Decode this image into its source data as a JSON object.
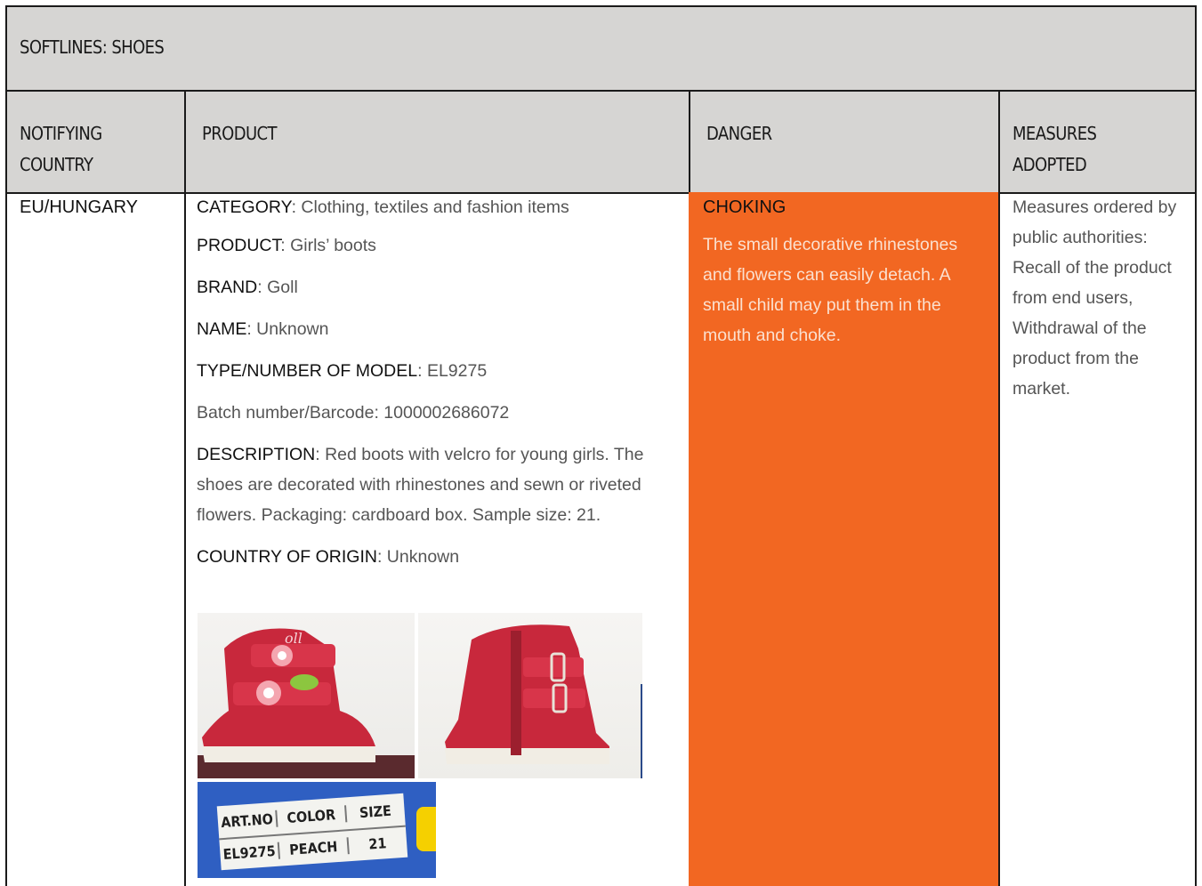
{
  "section": {
    "title": "SOFTLINES: SHOES"
  },
  "headers": {
    "country": "NOTIFYING COUNTRY",
    "product": "PRODUCT",
    "danger": "DANGER",
    "measures": "MEASURES ADOPTED"
  },
  "row": {
    "country": "EU/HUNGARY",
    "fields": {
      "category_label": "CATEGORY",
      "category": ": Clothing, textiles and fashion items",
      "product_label": "PRODUCT",
      "product": ": Girls’ boots",
      "brand_label": "BRAND",
      "brand": ": Goll",
      "name_label": "NAME",
      "name": ": Unknown",
      "model_label": "TYPE/NUMBER OF MODEL",
      "model": ": EL9275",
      "batch": "Batch number/Barcode: 1000002686072",
      "description_label": "DESCRIPTION",
      "description": ": Red boots with velcro for young girls. The shoes are decorated with rhinestones and sewn or riveted flowers. Packaging: cardboard box. Sample size: 21.",
      "origin_label": "COUNTRY OF ORIGIN",
      "origin": ": Unknown"
    },
    "danger": {
      "title": "CHOKING",
      "description": "The small decorative rhinestones and flowers can easily detach. A small child may put them in the mouth and choke."
    },
    "measures": "Measures ordered by public authorities: Recall of the product from end users, Withdrawal of the product from the market.",
    "label_photo": {
      "headers": [
        "ART.NO",
        "COLOR",
        "SIZE"
      ],
      "values": [
        "EL9275",
        "PEACH",
        "21"
      ]
    },
    "colors": {
      "danger_bg": "#f26722",
      "header_bg": "#d6d5d3",
      "boot_red": "#c8283c"
    }
  }
}
